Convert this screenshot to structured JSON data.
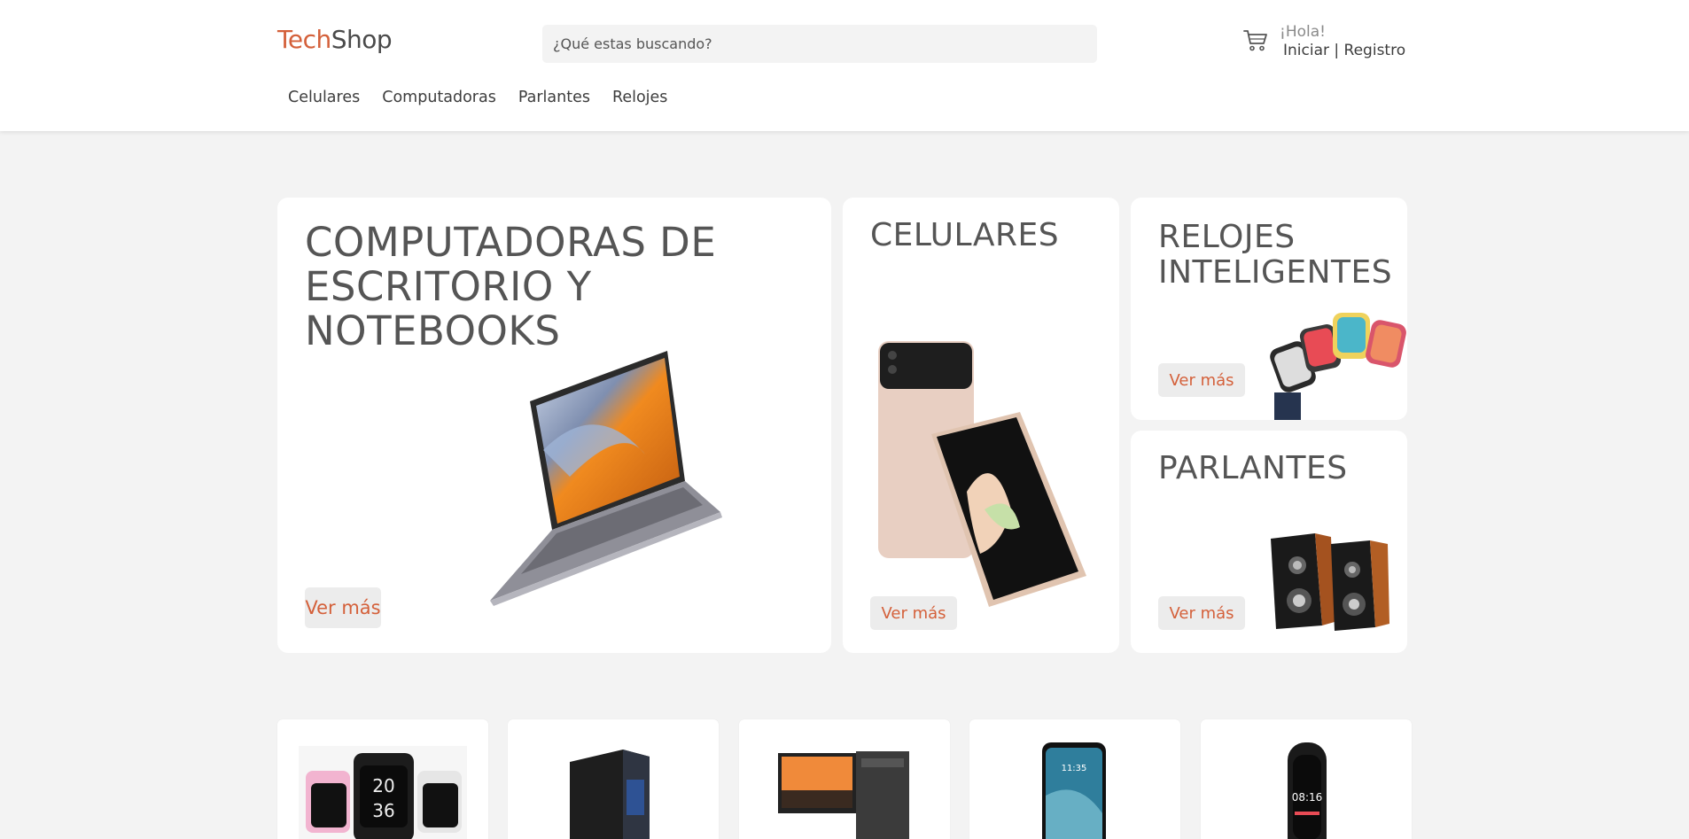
{
  "header": {
    "logo_tech": "Tech",
    "logo_shop": "Shop",
    "search_placeholder": "¿Qué estas buscando?",
    "greeting": "¡Hola!",
    "login": "Iniciar",
    "separator": " | ",
    "register": "Registro",
    "cart_icon": "cart-icon"
  },
  "nav": {
    "items": [
      {
        "label": "Celulares"
      },
      {
        "label": "Computadoras"
      },
      {
        "label": "Parlantes"
      },
      {
        "label": "Relojes"
      }
    ]
  },
  "categories": {
    "computadoras": {
      "title_line1": "COMPUTADORAS DE",
      "title_line2": "ESCRITORIO Y",
      "title_line3": "NOTEBOOKS",
      "button": "Ver más"
    },
    "celulares": {
      "title": "CELULARES",
      "button": "Ver más"
    },
    "relojes": {
      "title_line1": "RELOJES",
      "title_line2": "INTELIGENTES",
      "button": "Ver más"
    },
    "parlantes": {
      "title": "PARLANTES",
      "button": "Ver más"
    }
  },
  "products": [
    {
      "image": "smartwatch-set",
      "time_a": "20",
      "time_b": "36"
    },
    {
      "image": "pc-tower"
    },
    {
      "image": "desktop-computer"
    },
    {
      "image": "smartphone",
      "time": "11:35"
    },
    {
      "image": "fitness-band",
      "time": "08:16"
    }
  ],
  "colors": {
    "accent": "#d4603a",
    "background": "#f3f3f3",
    "card": "#ffffff",
    "text": "#555555"
  }
}
